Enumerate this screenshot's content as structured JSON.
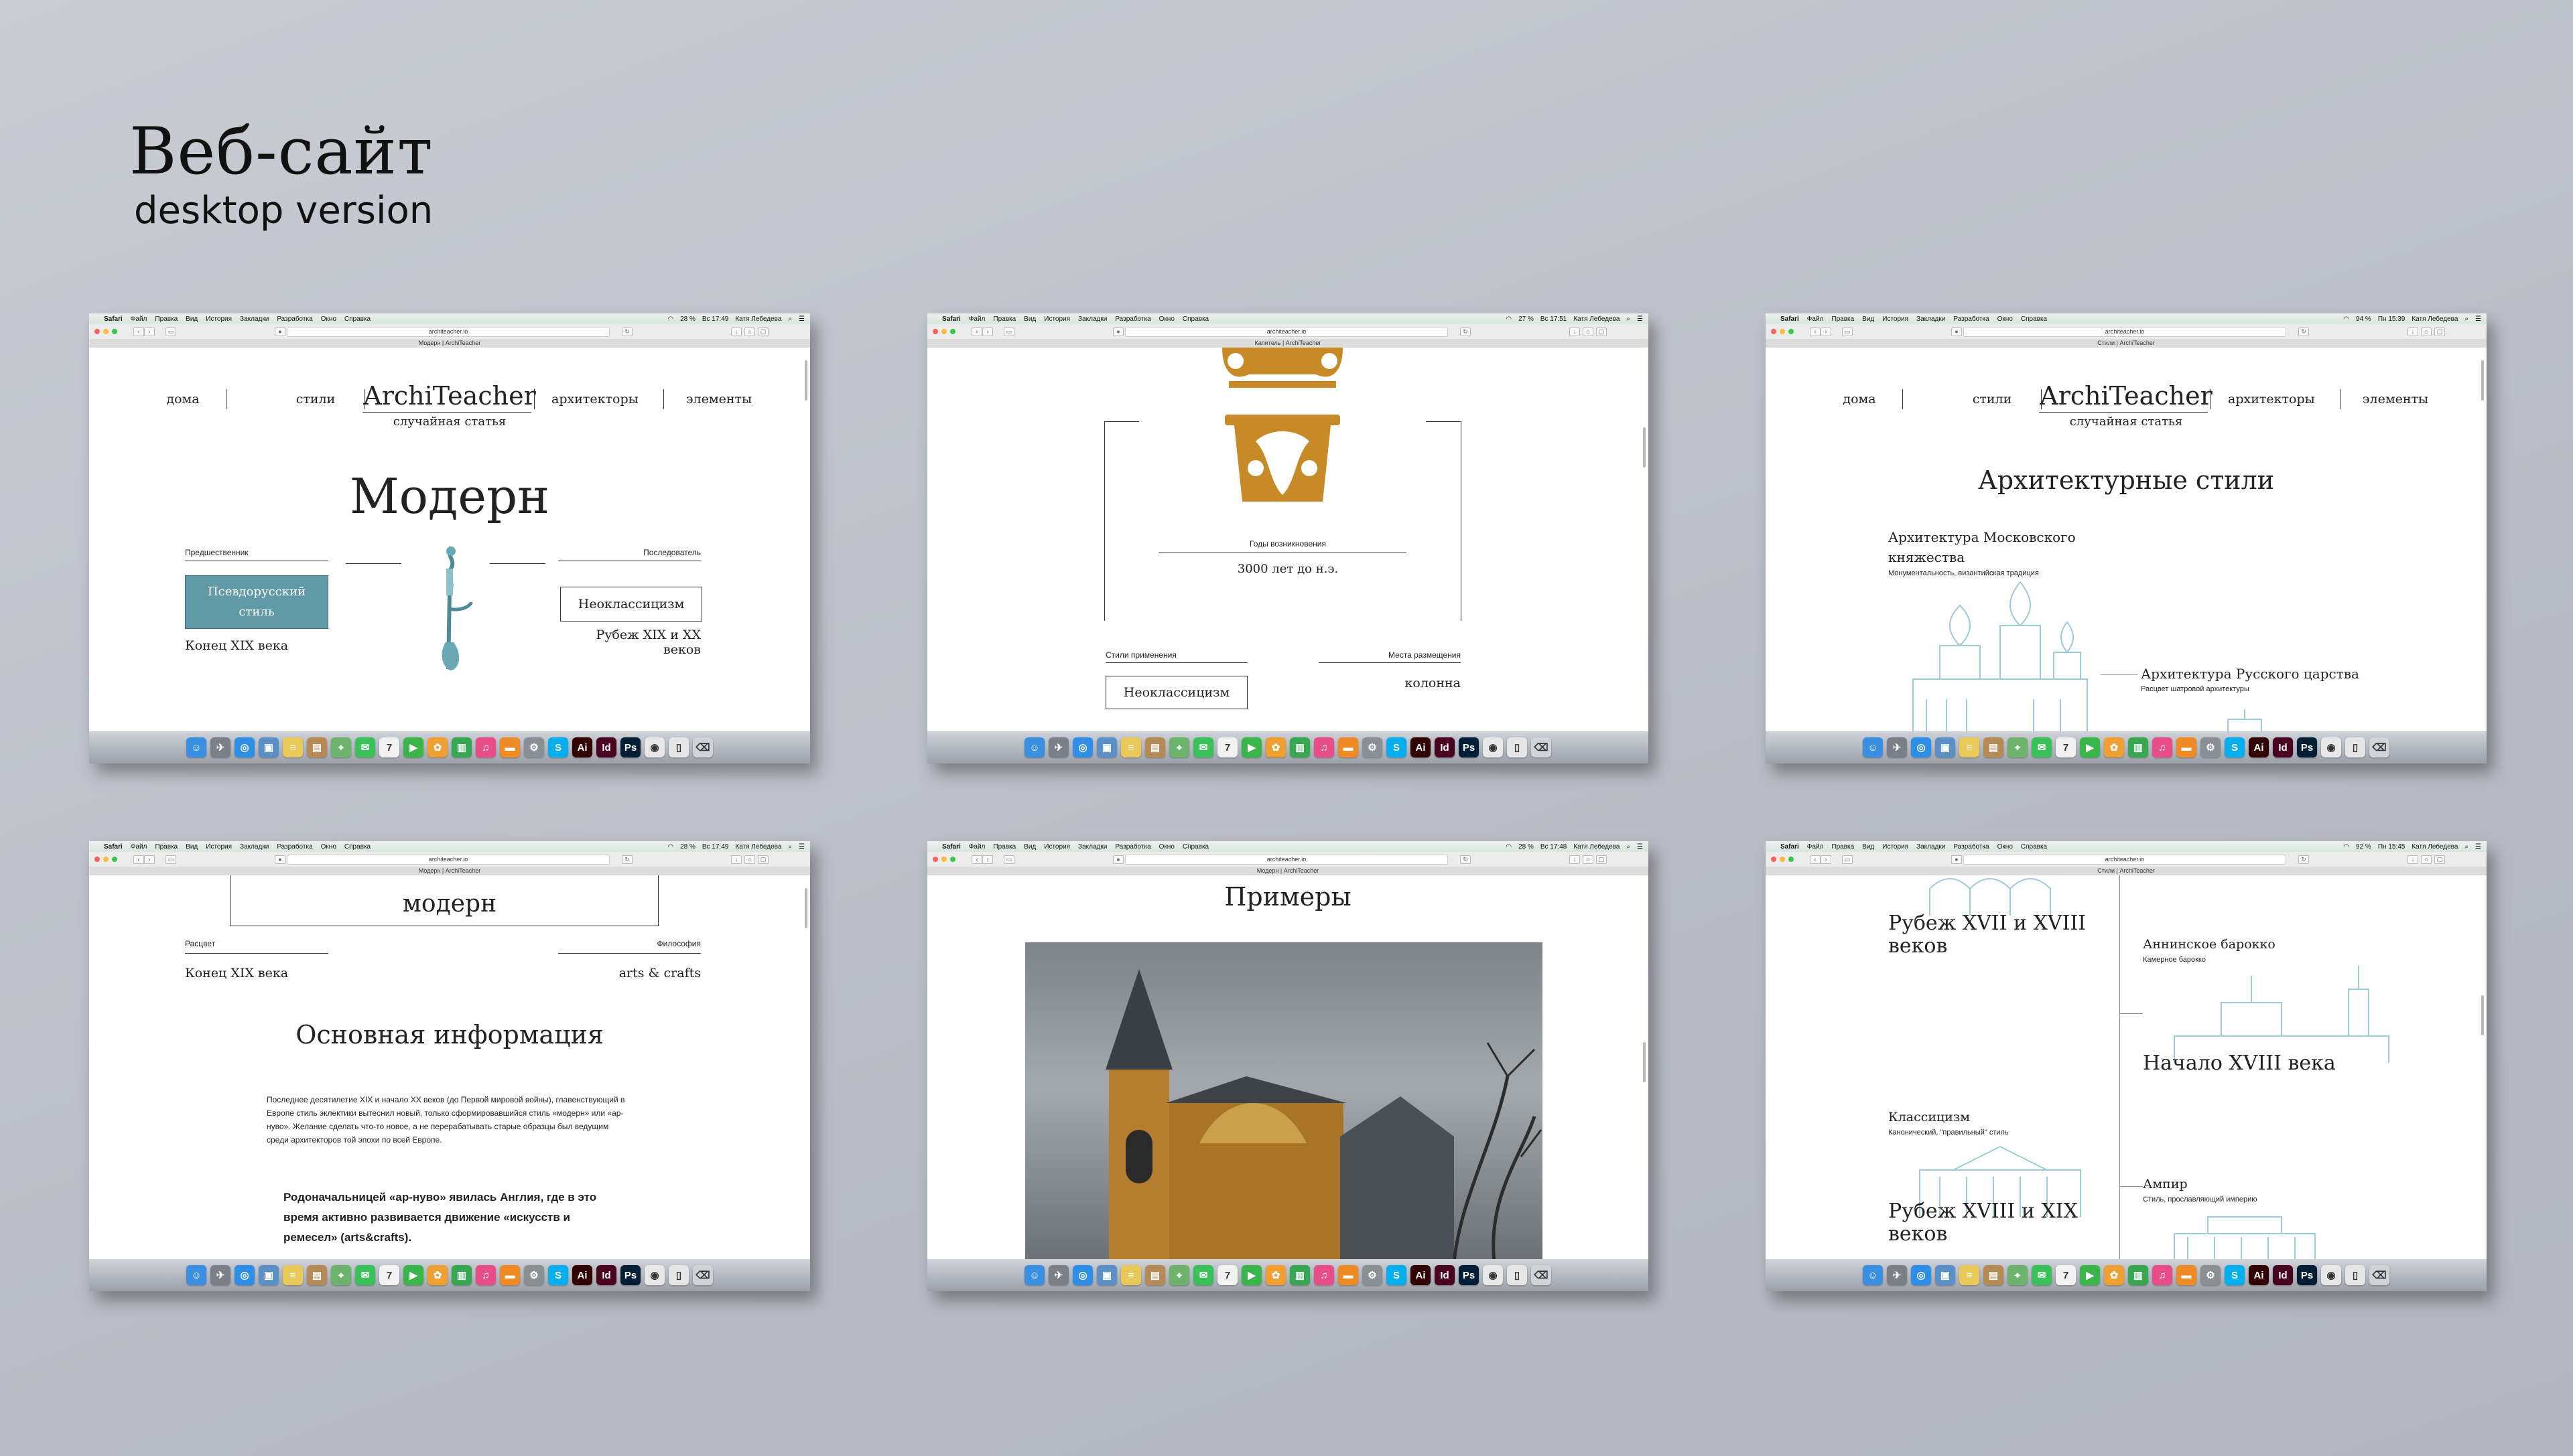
{
  "hero": {
    "title": "Веб-сайт",
    "subtitle": "desktop version"
  },
  "menubar": {
    "apple": "",
    "items": [
      "Safari",
      "Файл",
      "Правка",
      "Вид",
      "История",
      "Закладки",
      "Разработка",
      "Окно",
      "Справка"
    ],
    "shots": [
      {
        "battery": "28 %",
        "time": "Вс 17:49",
        "user": "Катя Лебедева"
      },
      {
        "battery": "27 %",
        "time": "Вс 17:51",
        "user": "Катя Лебедева"
      },
      {
        "battery": "94 %",
        "time": "Пн 15:39",
        "user": "Катя Лебедева"
      },
      {
        "battery": "28 %",
        "time": "Вс 17:49",
        "user": "Катя Лебедева"
      },
      {
        "battery": "28 %",
        "time": "Вс 17:48",
        "user": "Катя Лебедева"
      },
      {
        "battery": "92 %",
        "time": "Пн 15:45",
        "user": "Катя Лебедева"
      }
    ]
  },
  "url": "architeacher.io",
  "tabs": [
    "Модерн | ArchiTeacher",
    "Капитель | ArchiTeacher",
    "Стили | ArchiTeacher",
    "Модерн | ArchiTeacher",
    "Модерн | ArchiTeacher",
    "Стили | ArchiTeacher"
  ],
  "nav": {
    "home": "дома",
    "styles": "стили",
    "logo": "ArchiTeacher",
    "random": "случайная статья",
    "architects": "архитекторы",
    "elements": "элементы"
  },
  "s1": {
    "title": "Модерн",
    "prev_label": "Предшественник",
    "prev_style": "Псевдорусский стиль",
    "prev_period": "Конец XIX века",
    "next_label": "Последователь",
    "next_style": "Неоклассицизм",
    "next_period": "Рубеж XIX и XX веков"
  },
  "s2": {
    "origin_label": "Годы возникновения",
    "origin_value": "3000 лет до н.э.",
    "styles_label": "Стили применения",
    "styles_value": "Неоклассицизм",
    "place_label": "Места размещения",
    "place_value": "колонна"
  },
  "s3": {
    "title": "Архитектурные стили",
    "item1_title": "Архитектура Московского княжества",
    "item1_desc": "Монументальность, византийская традиция",
    "item2_title": "Архитектура Русского царства",
    "item2_desc": "Расцвет шатровой архитектуры"
  },
  "s4": {
    "box_title": "модерн",
    "bloom_label": "Расцвет",
    "bloom_value": "Конец XIX века",
    "philo_label": "Философия",
    "philo_value": "arts & crafts",
    "info_title": "Основная информация",
    "para1": "Последнее десятилетие XIX и начало XX веков (до Первой мировой войны), главенствующий в Европе стиль эклектики вытеснил новый, только сформировавшийся стиль «модерн» или «ар-нуво». Желание сделать что-то новое, а не перерабатывать старые образцы был ведущим среди архитекторов той эпохи по всей Европе.",
    "para2": "Родоначальницей «ар-нуво» явилась Англия, где в это время активно развивается движение «искусств и ремесел» (arts&crafts)."
  },
  "s5": {
    "title": "Примеры"
  },
  "s6": {
    "left1": "Рубеж XVII и XVIII веков",
    "right1_title": "Аннинское барокко",
    "right1_desc": "Камерное барокко",
    "right2": "Начало XVIII века",
    "left2_title": "Классицизм",
    "left2_desc": "Канонический, \"правильный\" стиль",
    "right3_title": "Ампир",
    "right3_desc": "Стиль, прославляющий империю",
    "left3": "Рубеж XVIII и XIX веков"
  },
  "dock": [
    {
      "name": "finder",
      "color": "#3b8fe0",
      "g": "☺"
    },
    {
      "name": "launchpad",
      "color": "#7a7f88",
      "g": "✈"
    },
    {
      "name": "safari",
      "color": "#2f8fe8",
      "g": "◎"
    },
    {
      "name": "preview",
      "color": "#5b8fc8",
      "g": "▣"
    },
    {
      "name": "notes",
      "color": "#e8c95a",
      "g": "≡"
    },
    {
      "name": "contacts",
      "color": "#b58a55",
      "g": "▤"
    },
    {
      "name": "maps",
      "color": "#6cb36c",
      "g": "⌖"
    },
    {
      "name": "messages",
      "color": "#3ac15a",
      "g": "✉"
    },
    {
      "name": "calendar",
      "color": "#f2f2f2",
      "g": "7"
    },
    {
      "name": "facetime",
      "color": "#39b54a",
      "g": "▶"
    },
    {
      "name": "photos",
      "color": "#f0a030",
      "g": "✿"
    },
    {
      "name": "numbers",
      "color": "#36a852",
      "g": "▥"
    },
    {
      "name": "itunes",
      "color": "#e84d8a",
      "g": "♫"
    },
    {
      "name": "ibooks",
      "color": "#f08a24",
      "g": "▬"
    },
    {
      "name": "settings",
      "color": "#8a8f96",
      "g": "⚙"
    },
    {
      "name": "skype",
      "color": "#00aff0",
      "g": "S"
    },
    {
      "name": "illustrator",
      "color": "#330000",
      "g": "Ai"
    },
    {
      "name": "indesign",
      "color": "#49021f",
      "g": "Id"
    },
    {
      "name": "photoshop",
      "color": "#001e36",
      "g": "Ps"
    },
    {
      "name": "chrome",
      "color": "#e8e8e8",
      "g": "◉"
    },
    {
      "name": "documents",
      "color": "#e6e6e6",
      "g": "▯"
    },
    {
      "name": "trash",
      "color": "#d0d3d8",
      "g": "⌫"
    }
  ]
}
